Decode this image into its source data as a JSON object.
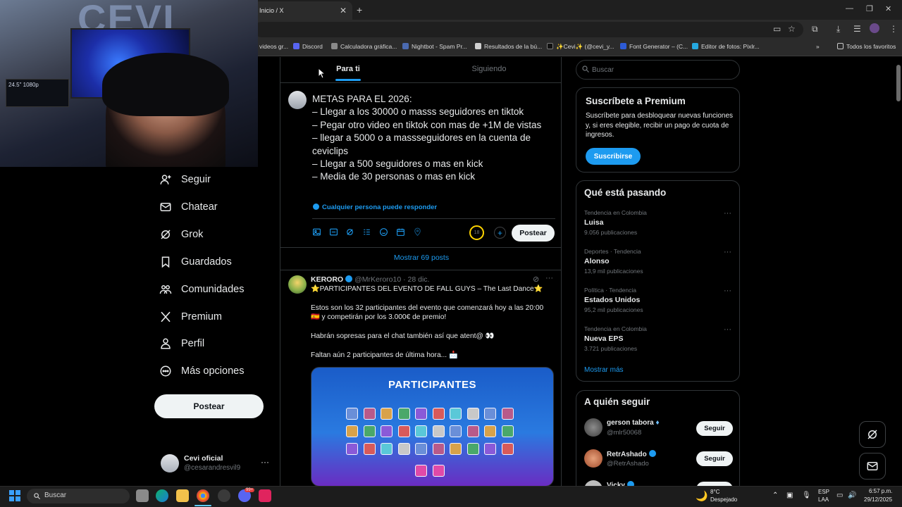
{
  "browser": {
    "tab_title": "Inicio / X",
    "bookmarks": [
      "videos gr...",
      "Discord",
      "Calculadora gráfica...",
      "Nightbot - Spam Pr...",
      "Resultados de la bú...",
      "✨Cevi✨ (@cevi_y...",
      "Font Generator – (C...",
      "Editor de fotos: Pixlr..."
    ],
    "bookmarks_all": "Todos los favoritos"
  },
  "sidebar": {
    "items": [
      {
        "label": "Seguir",
        "icon": "person-plus-icon"
      },
      {
        "label": "Chatear",
        "icon": "mail-icon"
      },
      {
        "label": "Grok",
        "icon": "grok-icon"
      },
      {
        "label": "Guardados",
        "icon": "bookmark-icon"
      },
      {
        "label": "Comunidades",
        "icon": "communities-icon"
      },
      {
        "label": "Premium",
        "icon": "x-logo-icon"
      },
      {
        "label": "Perfil",
        "icon": "person-icon"
      },
      {
        "label": "Más opciones",
        "icon": "more-circle-icon"
      }
    ],
    "post_button": "Postear",
    "profile": {
      "name": "Cevi oficial",
      "handle": "@cesarandresvil9"
    }
  },
  "feed": {
    "tabs": [
      "Para ti",
      "Siguiendo"
    ],
    "composer": {
      "text": "METAS PARA EL 2026:\n– Llegar a los 30000 o masss seguidores en tiktok\n– Pegar otro video en tiktok con mas de +1M de vistas\n– llegar a 5000 o a massseguidores en la cuenta de ceviclips\n– Llegar a 500 seguidores o mas en kick\n– Media de 30 personas o mas en kick",
      "reply_setting": "Cualquier persona puede responder",
      "char_count": "18",
      "post_button": "Postear"
    },
    "show_more_posts": "Mostrar 69 posts",
    "post": {
      "author": "KERORO",
      "handle": "@MrKeroro10",
      "date": "· 28 dic.",
      "lines": [
        "⭐PARTICIPANTES DEL EVENTO DE FALL GUYS – The Last Dance⭐",
        "Estos son los 32 participantes del evento que comenzará hoy a las 20:00",
        "🇪🇸 y competirán por los 3.000€ de premio!",
        "Habrán sopresas para el chat también así que atent@ 👀",
        "Faltan aún 2 participantes de última hora... 📩"
      ],
      "image_title": "PARTICIPANTES"
    }
  },
  "right": {
    "search_placeholder": "Buscar",
    "premium": {
      "title": "Suscríbete a Premium",
      "desc": "Suscríbete para desbloquear nuevas funciones y, si eres elegible, recibir un pago de cuota de ingresos.",
      "button": "Suscribirse"
    },
    "trends": {
      "title": "Qué está pasando",
      "items": [
        {
          "context": "Tendencia en Colombia",
          "name": "Luisa",
          "count": "9.056 publicaciones"
        },
        {
          "context": "Deportes · Tendencia",
          "name": "Alonso",
          "count": "13,9 mil publicaciones"
        },
        {
          "context": "Política · Tendencia",
          "name": "Estados Unidos",
          "count": "95,2 mil publicaciones"
        },
        {
          "context": "Tendencia en Colombia",
          "name": "Nueva EPS",
          "count": "3.721 publicaciones"
        }
      ],
      "show_more": "Mostrar más"
    },
    "who_to_follow": {
      "title": "A quién seguir",
      "items": [
        {
          "name": "gerson tabora",
          "handle": "@mlr50068",
          "button": "Seguir"
        },
        {
          "name": "RetrAshado",
          "handle": "@RetrAshado",
          "button": "Seguir"
        },
        {
          "name": "Vicky",
          "handle": "",
          "button": "Seguir"
        }
      ]
    }
  },
  "taskbar": {
    "search": "Buscar",
    "weather_temp": "8°C",
    "weather_desc": "Despejado",
    "lang": "ESP",
    "lang2": "LAA",
    "time": "6:57 p.m.",
    "date": "29/12/2025",
    "discord_badge": "99+"
  },
  "webcam": {
    "logo_text": "CEVI",
    "monitor_text": "24.5\" 1080p"
  },
  "colors": {
    "accent": "#1d9bf0",
    "bg": "#000000",
    "border": "#2f3336",
    "muted": "#71767b"
  }
}
